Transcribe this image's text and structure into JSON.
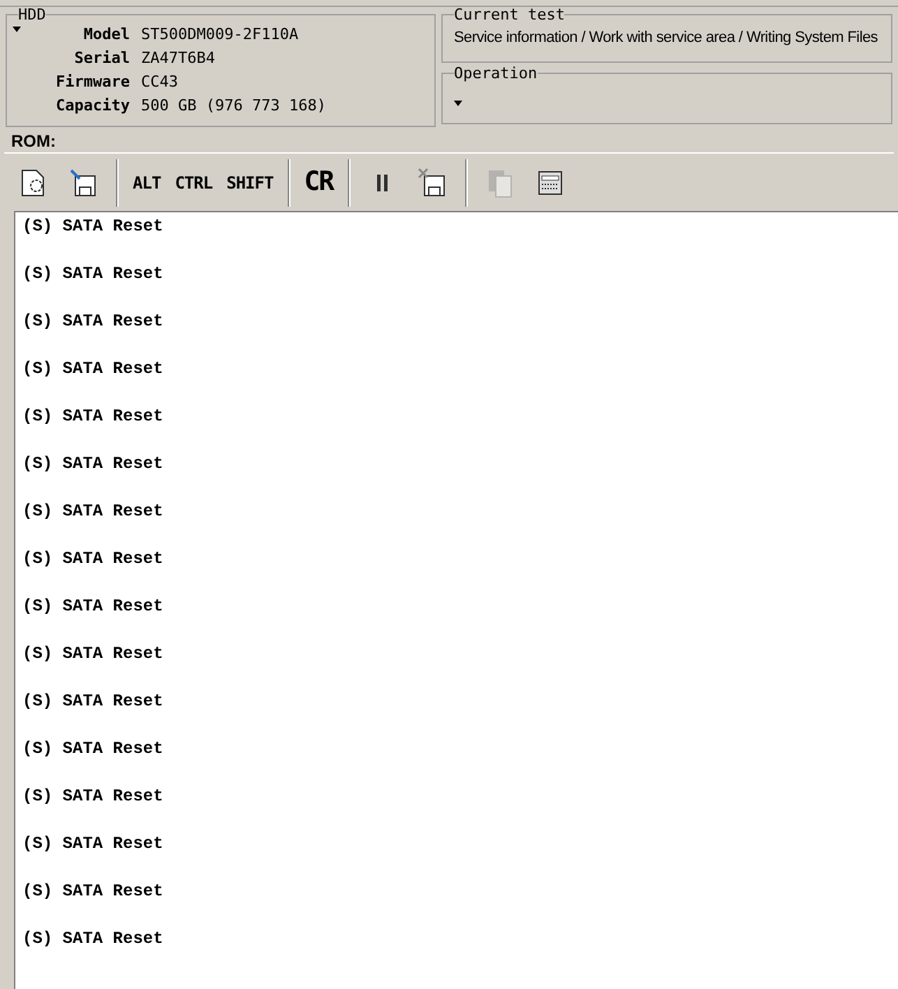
{
  "hdd": {
    "title": "HDD",
    "fields": [
      {
        "label": "Model",
        "value": "ST500DM009-2F110A"
      },
      {
        "label": "Serial",
        "value": "ZA47T6B4"
      },
      {
        "label": "Firmware",
        "value": "CC43"
      },
      {
        "label": "Capacity",
        "value": "500 GB (976 773 168)"
      }
    ]
  },
  "current_test": {
    "title": "Current test",
    "value": "Service information / Work with service area / Writing System Files"
  },
  "operation": {
    "title": "Operation"
  },
  "rom": {
    "label": "ROM:"
  },
  "toolbar": [
    {
      "kind": "load",
      "disabled": false
    },
    {
      "kind": "save",
      "disabled": false
    },
    {
      "kind": "sep"
    },
    {
      "kind": "text",
      "label": "ALT"
    },
    {
      "kind": "text",
      "label": "CTRL"
    },
    {
      "kind": "text",
      "label": "SHIFT"
    },
    {
      "kind": "sep"
    },
    {
      "kind": "big",
      "label": "CR"
    },
    {
      "kind": "sep"
    },
    {
      "kind": "pause",
      "disabled": false
    },
    {
      "kind": "unsave",
      "disabled": false
    },
    {
      "kind": "sep"
    },
    {
      "kind": "copy",
      "disabled": true
    },
    {
      "kind": "terminal",
      "disabled": false
    }
  ],
  "log": [
    "(S) SATA Reset",
    "(S) SATA Reset",
    "(S) SATA Reset",
    "(S) SATA Reset",
    "(S) SATA Reset",
    "(S) SATA Reset",
    "(S) SATA Reset",
    "(S) SATA Reset",
    "(S) SATA Reset",
    "(S) SATA Reset",
    "(S) SATA Reset",
    "(S) SATA Reset",
    "(S) SATA Reset",
    "(S) SATA Reset",
    "(S) SATA Reset",
    "(S) SATA Reset"
  ]
}
